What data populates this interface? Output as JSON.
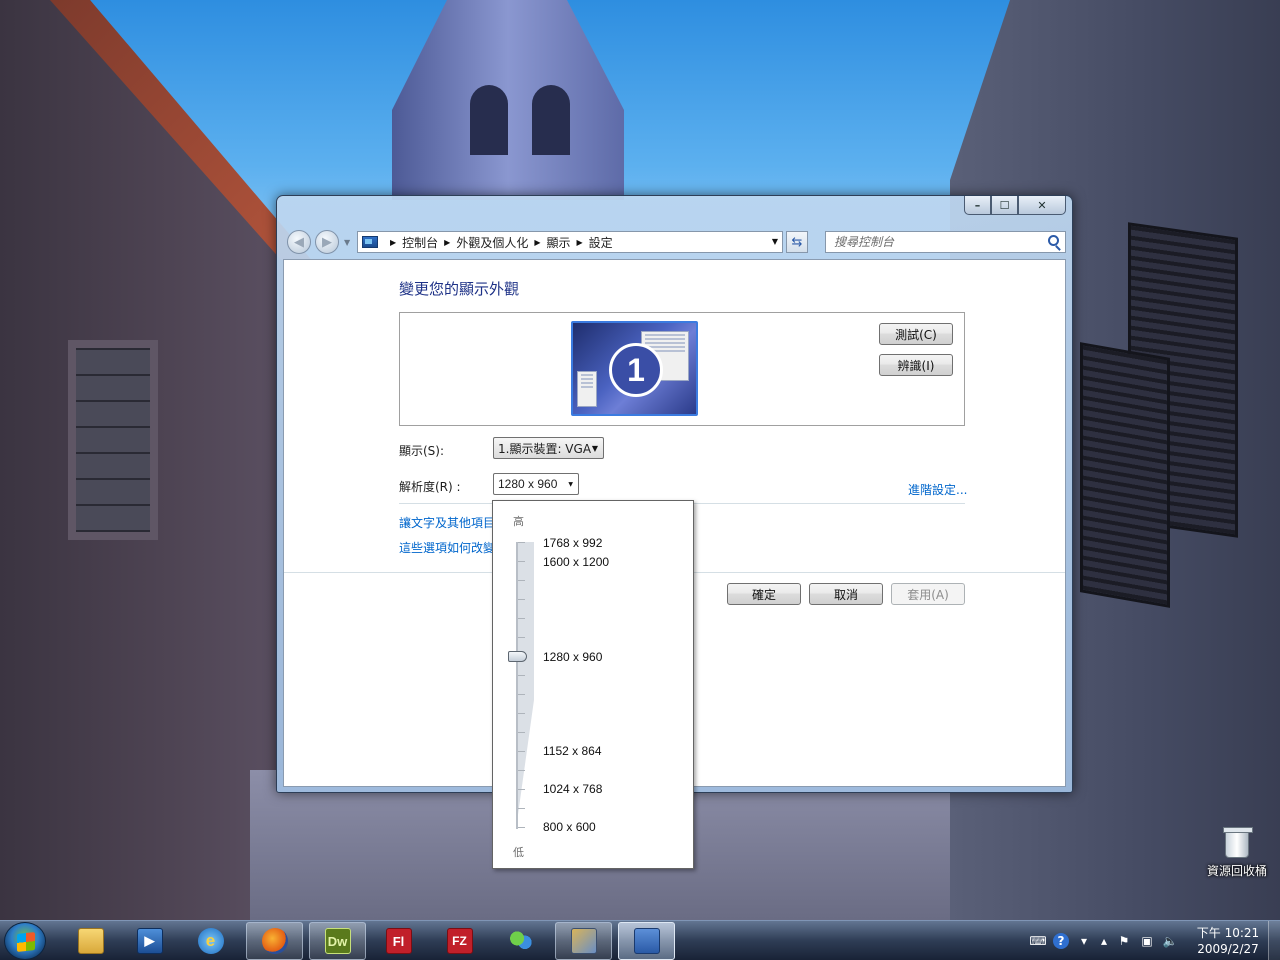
{
  "window": {
    "controls": {
      "minimize": "–",
      "maximize": "☐",
      "close": "✕"
    },
    "nav": {
      "back": "◀",
      "forward": "▶"
    },
    "breadcrumb": [
      "控制台",
      "外觀及個人化",
      "顯示",
      "設定"
    ],
    "search_placeholder": "搜尋控制台"
  },
  "page": {
    "title": "變更您的顯示外觀",
    "monitor_number": "1",
    "detect_button": "測試(C)",
    "identify_button": "辨識(I)",
    "display_label": "顯示(S):",
    "display_value": "1.顯示裝置: VGA",
    "resolution_label": "解析度(R) :",
    "resolution_value": "1280 x 960",
    "advanced_link": "進階設定...",
    "link_text_size": "讓文字及其他項目",
    "link_which_settings": "這些選項如何改變",
    "ok_button": "確定",
    "cancel_button": "取消",
    "apply_button": "套用(A)"
  },
  "resolution_popup": {
    "high_label": "高",
    "low_label": "低",
    "options": [
      "1768 x 992",
      "1600 x 1200",
      "1280 x 960",
      "1152 x 864",
      "1024 x 768",
      "800 x 600"
    ],
    "selected": "1280 x 960"
  },
  "desktop": {
    "recycle_bin_label": "資源回收桶"
  },
  "taskbar": {
    "apps": [
      {
        "name": "windows-explorer",
        "running": false
      },
      {
        "name": "media-player",
        "running": false
      },
      {
        "name": "internet-explorer",
        "running": false
      },
      {
        "name": "firefox",
        "running": true,
        "text": ""
      },
      {
        "name": "dreamweaver",
        "running": true,
        "text": "Dw",
        "color": "#5a7a1c"
      },
      {
        "name": "flash",
        "running": false,
        "text": "Fl",
        "color": "#c1202a"
      },
      {
        "name": "filezilla",
        "running": false,
        "text": "FZ",
        "color": "#c1202a"
      },
      {
        "name": "messenger",
        "running": false
      },
      {
        "name": "photo-app",
        "running": true
      },
      {
        "name": "display-settings",
        "running": true,
        "active": true
      }
    ],
    "clock_time": "下午 10:21",
    "clock_date": "2009/2/27"
  }
}
